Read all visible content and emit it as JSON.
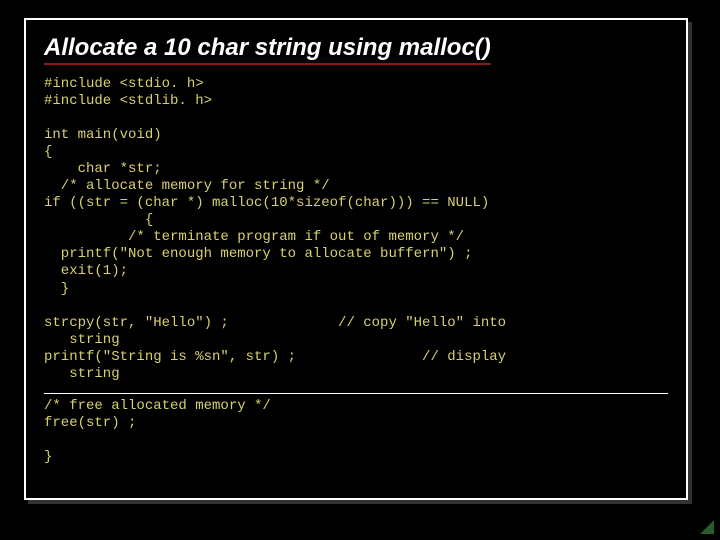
{
  "title": "Allocate a 10 char string using malloc()",
  "code": {
    "l0": "#include <stdio. h>",
    "l1": "#include <stdlib. h>",
    "l2": "int main(void)",
    "l3": "{",
    "l4": "    char *str;",
    "l5": "  /* allocate memory for string */",
    "l6": "if ((str = (char *) malloc(10*sizeof(char))) == NULL)",
    "l7": "            {",
    "l8": "          /* terminate program if out of memory */",
    "l9": "  printf(\"Not enough memory to allocate buffern\") ;",
    "l10": "  exit(1);",
    "l11": "  }",
    "l12": "strcpy(str, \"Hello\") ;             // copy \"Hello\" into",
    "l13": "   string",
    "l14": "printf(\"String is %sn\", str) ;               // display",
    "l15": "   string",
    "l16": "/* free allocated memory */",
    "l17": "free(str) ;",
    "l18": "}"
  }
}
